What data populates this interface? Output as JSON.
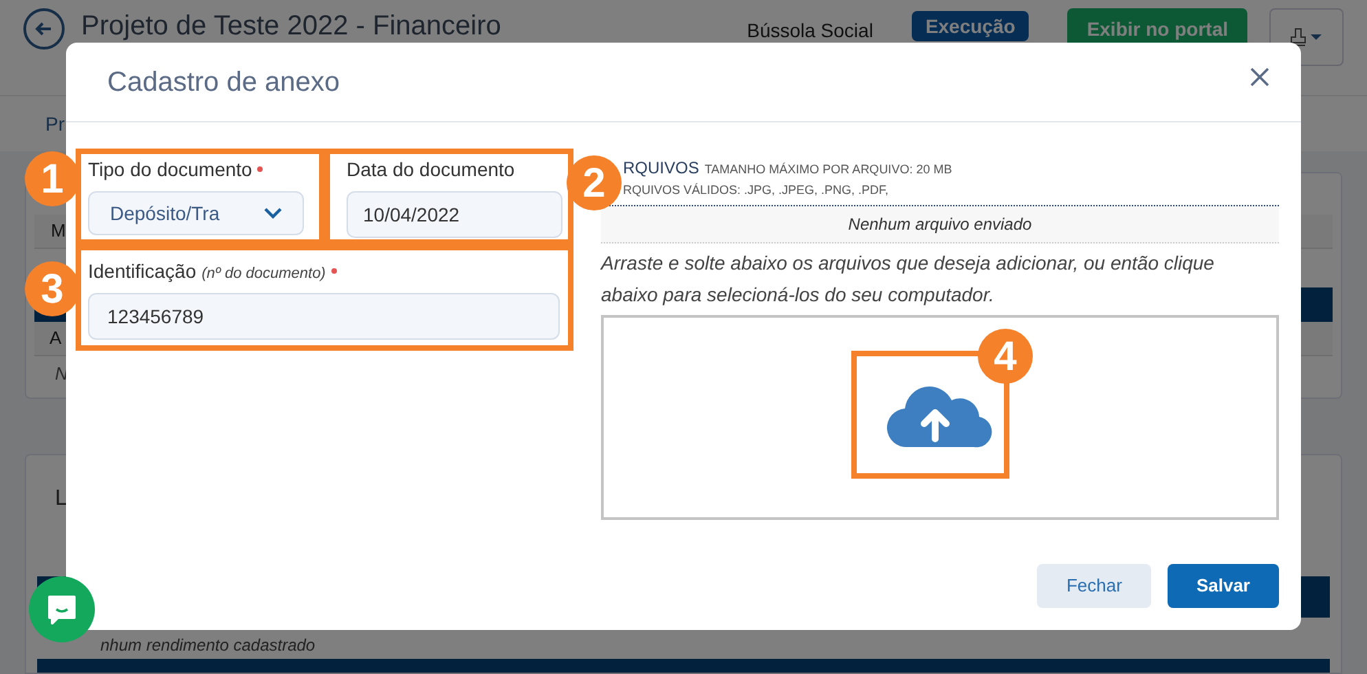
{
  "background": {
    "title": "Projeto de Teste 2022 - Financeiro",
    "organization": "Bússola Social",
    "status_badge": "Execução",
    "portal_button": "Exibir no portal",
    "tab": "Pr",
    "table_fragments": [
      "M",
      "A",
      "N"
    ],
    "section_fragment": "L",
    "empty_message": "nhum rendimento cadastrado"
  },
  "modal": {
    "title": "Cadastro de anexo",
    "document_type": {
      "label": "Tipo do documento",
      "required": true,
      "value": "Depósito/Tra"
    },
    "document_date": {
      "label": "Data do documento",
      "value": "10/04/2022"
    },
    "identification": {
      "label": "Identificação",
      "hint": "(nº do documento)",
      "required": true,
      "value": "123456789"
    },
    "files": {
      "heading": "RQUIVOS",
      "max_size": "TAMANHO MÁXIMO POR ARQUIVO: 20 MB",
      "valid_types": "RQUIVOS VÁLIDOS: .JPG, .JPEG, .PNG, .PDF,",
      "empty_message": "Nenhum arquivo enviado",
      "instructions": "Arraste e solte abaixo os arquivos que deseja adicionar, ou então clique abaixo para selecioná-los do seu computador."
    },
    "buttons": [
      {
        "label": "Fechar",
        "kind": "secondary"
      },
      {
        "label": "Salvar",
        "kind": "primary"
      }
    ]
  },
  "annotations": [
    {
      "label": "1"
    },
    {
      "label": "2"
    },
    {
      "label": "3"
    },
    {
      "label": "4"
    }
  ]
}
